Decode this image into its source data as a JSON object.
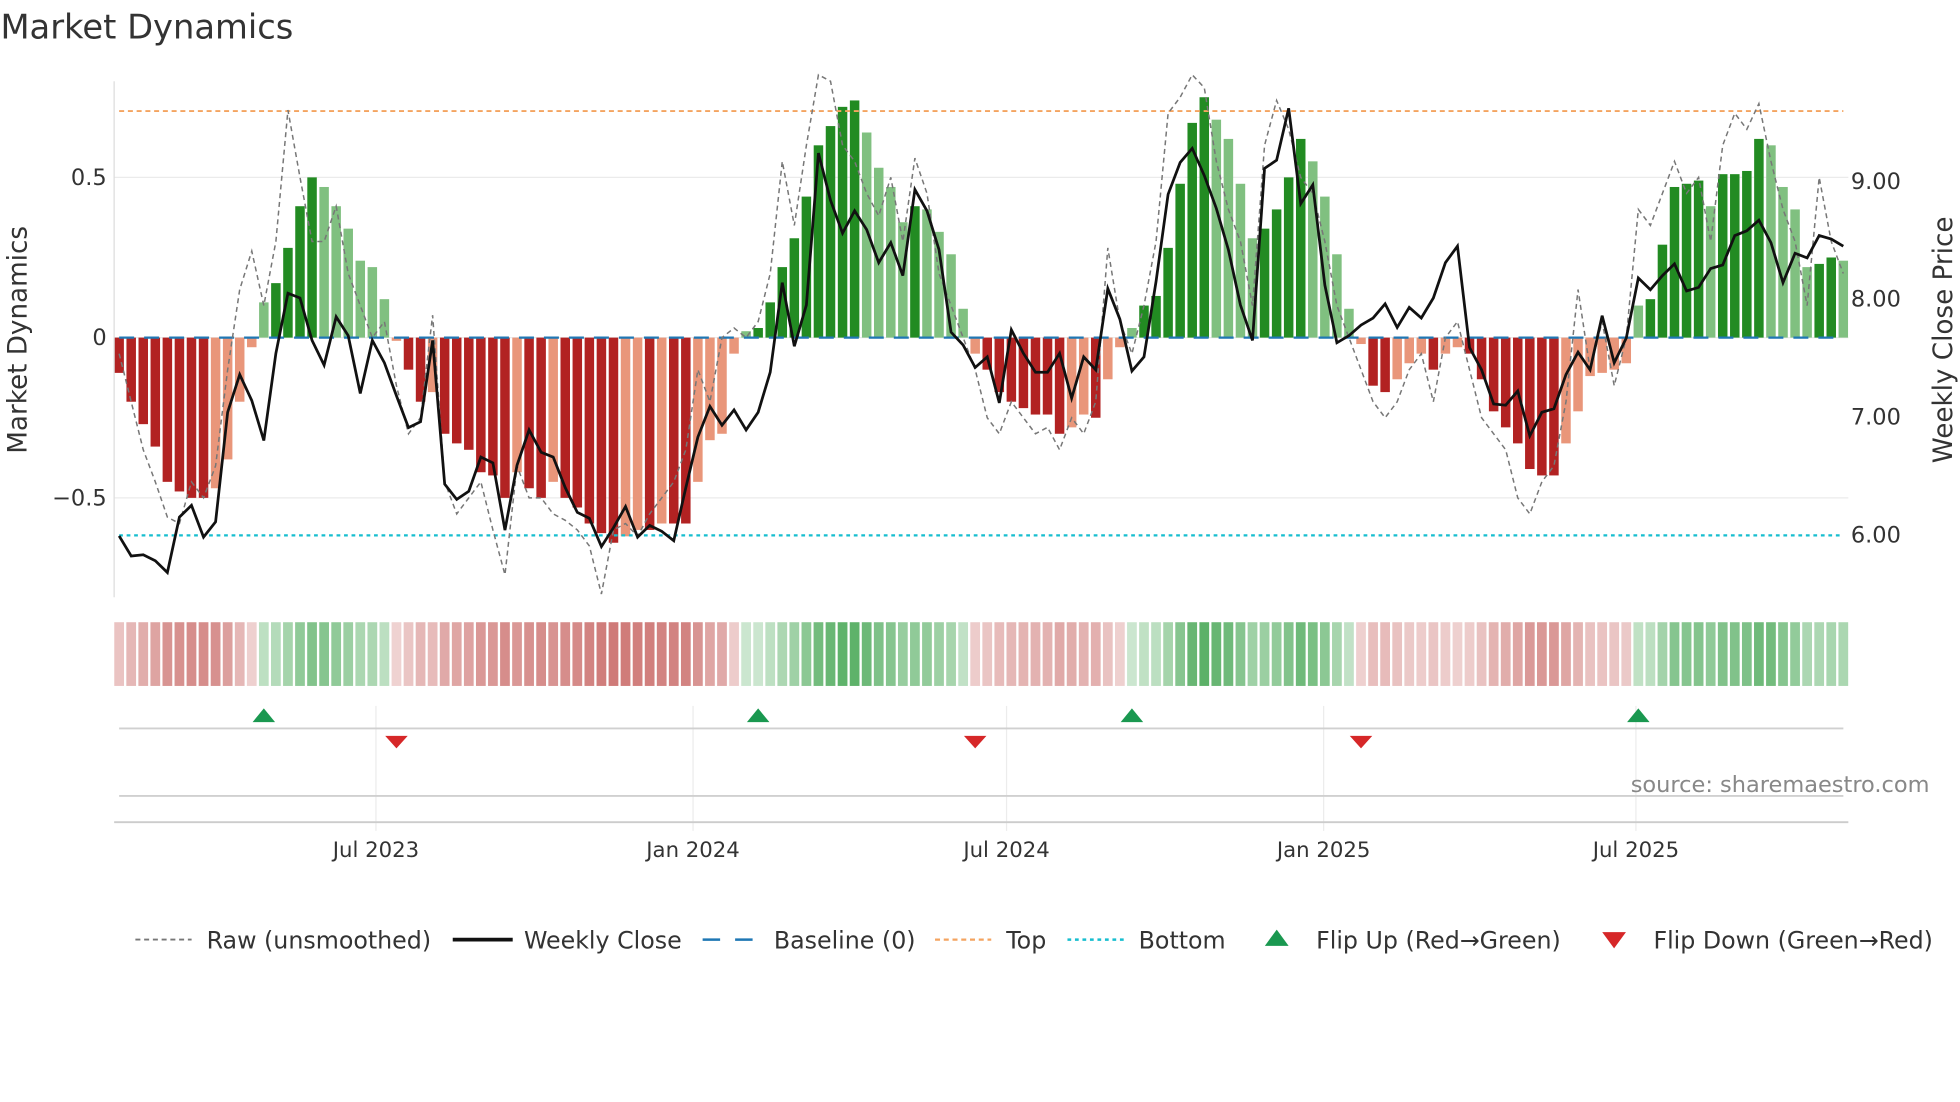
{
  "chart_data": {
    "type": "bar",
    "title": "Market Dynamics",
    "ylabel": "Market Dynamics",
    "y2label": "Weekly Close Price",
    "ylim": [
      -0.81,
      0.8
    ],
    "y2lim": [
      5.46,
      9.84
    ],
    "start_week": "2023-02-03",
    "yticks": [
      {
        "v": 0.5,
        "label": "0.5"
      },
      {
        "v": 0,
        "label": "0"
      },
      {
        "v": -0.5,
        "label": "−0.5"
      }
    ],
    "y2ticks": [
      {
        "v": 9,
        "label": "9.00"
      },
      {
        "v": 8,
        "label": "8.00"
      },
      {
        "v": 7,
        "label": "7.00"
      },
      {
        "v": 6,
        "label": "6.00"
      }
    ],
    "xticks": [
      {
        "week": 21.3,
        "label": "Jul 2023"
      },
      {
        "week": 47.6,
        "label": "Jan 2024"
      },
      {
        "week": 73.6,
        "label": "Jul 2024"
      },
      {
        "week": 99.9,
        "label": "Jan 2025"
      },
      {
        "week": 125.8,
        "label": "Jul 2025"
      }
    ],
    "top_level": 0.707,
    "bottom_level": -0.617,
    "dynamics": [
      -0.11,
      -0.2,
      -0.27,
      -0.34,
      -0.45,
      -0.48,
      -0.5,
      -0.5,
      -0.47,
      -0.38,
      -0.2,
      -0.03,
      0.11,
      0.17,
      0.28,
      0.41,
      0.5,
      0.47,
      0.41,
      0.34,
      0.24,
      0.22,
      0.12,
      -0.01,
      -0.1,
      -0.2,
      -0.17,
      -0.3,
      -0.33,
      -0.35,
      -0.42,
      -0.43,
      -0.5,
      -0.42,
      -0.47,
      -0.5,
      -0.45,
      -0.5,
      -0.53,
      -0.58,
      -0.61,
      -0.64,
      -0.62,
      -0.6,
      -0.6,
      -0.58,
      -0.58,
      -0.58,
      -0.45,
      -0.32,
      -0.3,
      -0.05,
      0.02,
      0.03,
      0.11,
      0.22,
      0.31,
      0.44,
      0.6,
      0.66,
      0.72,
      0.74,
      0.64,
      0.53,
      0.47,
      0.36,
      0.41,
      0.4,
      0.33,
      0.26,
      0.09,
      -0.05,
      -0.1,
      -0.17,
      -0.2,
      -0.22,
      -0.24,
      -0.24,
      -0.3,
      -0.28,
      -0.24,
      -0.25,
      -0.13,
      -0.03,
      0.03,
      0.1,
      0.13,
      0.28,
      0.48,
      0.67,
      0.75,
      0.68,
      0.62,
      0.48,
      0.31,
      0.34,
      0.4,
      0.5,
      0.62,
      0.55,
      0.44,
      0.26,
      0.09,
      -0.02,
      -0.15,
      -0.17,
      -0.13,
      -0.08,
      -0.05,
      -0.1,
      -0.05,
      -0.03,
      -0.05,
      -0.13,
      -0.23,
      -0.28,
      -0.33,
      -0.41,
      -0.43,
      -0.43,
      -0.33,
      -0.23,
      -0.12,
      -0.11,
      -0.1,
      -0.08,
      0.1,
      0.12,
      0.29,
      0.47,
      0.48,
      0.49,
      0.41,
      0.51,
      0.51,
      0.52,
      0.62,
      0.6,
      0.47,
      0.4,
      0.22,
      0.23,
      0.25,
      0.24
    ],
    "raw": [
      -0.05,
      -0.2,
      -0.35,
      -0.45,
      -0.56,
      -0.58,
      -0.45,
      -0.5,
      -0.4,
      -0.1,
      0.15,
      0.27,
      0.1,
      0.3,
      0.71,
      0.5,
      0.3,
      0.3,
      0.41,
      0.2,
      0.1,
      0.0,
      0.05,
      -0.15,
      -0.3,
      -0.25,
      0.07,
      -0.45,
      -0.55,
      -0.5,
      -0.45,
      -0.6,
      -0.74,
      -0.4,
      -0.5,
      -0.5,
      -0.55,
      -0.57,
      -0.6,
      -0.65,
      -0.8,
      -0.6,
      -0.58,
      -0.62,
      -0.55,
      -0.5,
      -0.45,
      -0.35,
      -0.1,
      -0.2,
      0.0,
      0.03,
      0.0,
      0.05,
      0.2,
      0.55,
      0.35,
      0.6,
      0.82,
      0.8,
      0.6,
      0.55,
      0.45,
      0.38,
      0.5,
      0.3,
      0.56,
      0.45,
      0.2,
      0.1,
      0.0,
      -0.1,
      -0.25,
      -0.3,
      -0.2,
      -0.25,
      -0.3,
      -0.28,
      -0.35,
      -0.25,
      -0.3,
      -0.2,
      0.28,
      0.05,
      -0.05,
      0.1,
      0.3,
      0.7,
      0.75,
      0.82,
      0.78,
      0.55,
      0.4,
      0.3,
      0.1,
      0.6,
      0.74,
      0.65,
      0.5,
      0.45,
      0.3,
      0.1,
      0.0,
      -0.1,
      -0.2,
      -0.25,
      -0.2,
      -0.1,
      -0.05,
      -0.2,
      0.0,
      0.05,
      -0.1,
      -0.25,
      -0.3,
      -0.35,
      -0.5,
      -0.55,
      -0.45,
      -0.4,
      -0.2,
      0.15,
      -0.1,
      0.05,
      -0.15,
      0.0,
      0.4,
      0.35,
      0.45,
      0.55,
      0.45,
      0.5,
      0.3,
      0.6,
      0.7,
      0.65,
      0.73,
      0.55,
      0.4,
      0.3,
      0.1,
      0.5,
      0.3,
      0.2
    ],
    "close": [
      5.98,
      5.81,
      5.82,
      5.77,
      5.67,
      6.14,
      6.24,
      5.97,
      6.1,
      7.03,
      7.35,
      7.13,
      6.79,
      7.53,
      8.04,
      8.0,
      7.64,
      7.43,
      7.84,
      7.68,
      7.19,
      7.64,
      7.45,
      7.17,
      6.9,
      6.95,
      7.64,
      6.42,
      6.29,
      6.36,
      6.65,
      6.6,
      6.03,
      6.58,
      6.88,
      6.69,
      6.65,
      6.39,
      6.18,
      6.13,
      5.89,
      6.05,
      6.23,
      5.97,
      6.07,
      6.02,
      5.94,
      6.39,
      6.82,
      7.08,
      6.92,
      7.05,
      6.88,
      7.03,
      7.37,
      8.13,
      7.59,
      7.94,
      9.23,
      8.83,
      8.55,
      8.74,
      8.58,
      8.3,
      8.47,
      8.19,
      8.92,
      8.74,
      8.41,
      7.71,
      7.6,
      7.41,
      7.5,
      7.11,
      7.73,
      7.53,
      7.37,
      7.37,
      7.53,
      7.15,
      7.5,
      7.39,
      8.08,
      7.82,
      7.38,
      7.5,
      8.14,
      8.88,
      9.15,
      9.27,
      9.04,
      8.76,
      8.41,
      7.94,
      7.64,
      9.1,
      9.17,
      9.61,
      8.8,
      8.96,
      8.11,
      7.62,
      7.68,
      7.77,
      7.83,
      7.95,
      7.75,
      7.92,
      7.83,
      8.0,
      8.3,
      8.44,
      7.58,
      7.39,
      7.1,
      7.09,
      7.21,
      6.83,
      7.03,
      7.06,
      7.35,
      7.54,
      7.39,
      7.85,
      7.45,
      7.66,
      8.17,
      8.07,
      8.19,
      8.29,
      8.06,
      8.09,
      8.25,
      8.28,
      8.53,
      8.57,
      8.66,
      8.47,
      8.13,
      8.38,
      8.34,
      8.53,
      8.5,
      8.44
    ],
    "flips": [
      {
        "type": "up",
        "week": 12
      },
      {
        "type": "down",
        "week": 23
      },
      {
        "type": "up",
        "week": 53
      },
      {
        "type": "down",
        "week": 71
      },
      {
        "type": "up",
        "week": 84
      },
      {
        "type": "down",
        "week": 103
      },
      {
        "type": "up",
        "week": 126
      }
    ],
    "legend": [
      {
        "kind": "raw",
        "label": "Raw (unsmoothed)"
      },
      {
        "kind": "close",
        "label": "Weekly Close"
      },
      {
        "kind": "baseline",
        "label": "Baseline (0)"
      },
      {
        "kind": "top",
        "label": "Top"
      },
      {
        "kind": "bottom",
        "label": "Bottom"
      },
      {
        "kind": "up",
        "label": "Flip Up (Red→Green)"
      },
      {
        "kind": "down",
        "label": "Flip Down (Green→Red)"
      }
    ],
    "legend_placement": "bottom",
    "source": "source: sharemaestro.com",
    "colors": {
      "green_strong": "#228b22",
      "green_light": "#80c080",
      "red_strong": "#b22222",
      "red_light": "#e9967a",
      "top": "#f4a460",
      "bottom": "#17becf",
      "baseline": "#1f77b4",
      "close": "#111111",
      "raw": "#777777",
      "flip_up": "#1a9850",
      "flip_down": "#d62728"
    }
  }
}
